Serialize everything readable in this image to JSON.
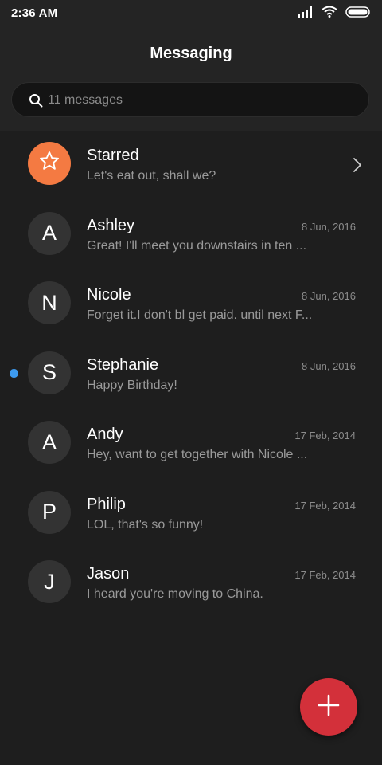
{
  "status_bar": {
    "time": "2:36 AM",
    "icons": [
      "signal-icon",
      "wifi-icon",
      "battery-icon"
    ]
  },
  "header": {
    "title": "Messaging"
  },
  "search": {
    "placeholder": "11 messages",
    "icon": "search-icon"
  },
  "starred": {
    "name": "Starred",
    "preview": "Let's eat out, shall we?",
    "icon": "star-icon",
    "accent_color": "#f47a42"
  },
  "conversations": [
    {
      "initial": "A",
      "name": "Ashley",
      "date": "8 Jun, 2016",
      "preview": "Great! I'll meet you downstairs in ten ...",
      "unread": false
    },
    {
      "initial": "N",
      "name": "Nicole",
      "date": "8 Jun, 2016",
      "preview": "Forget it.I don't bl get paid. until next F...",
      "unread": false
    },
    {
      "initial": "S",
      "name": "Stephanie",
      "date": "8 Jun, 2016",
      "preview": "Happy Birthday!",
      "unread": true
    },
    {
      "initial": "A",
      "name": "Andy",
      "date": "17 Feb, 2014",
      "preview": "Hey, want to get together with Nicole ...",
      "unread": false
    },
    {
      "initial": "P",
      "name": "Philip",
      "date": "17 Feb, 2014",
      "preview": "LOL, that's so funny!",
      "unread": false
    },
    {
      "initial": "J",
      "name": "Jason",
      "date": "17 Feb, 2014",
      "preview": "I heard you're moving to China.",
      "unread": false
    }
  ],
  "fab": {
    "icon": "plus-icon",
    "color": "#d3303a"
  },
  "colors": {
    "background": "#1e1e1e",
    "header_background": "#242424",
    "unread_dot": "#3d9bf0"
  }
}
